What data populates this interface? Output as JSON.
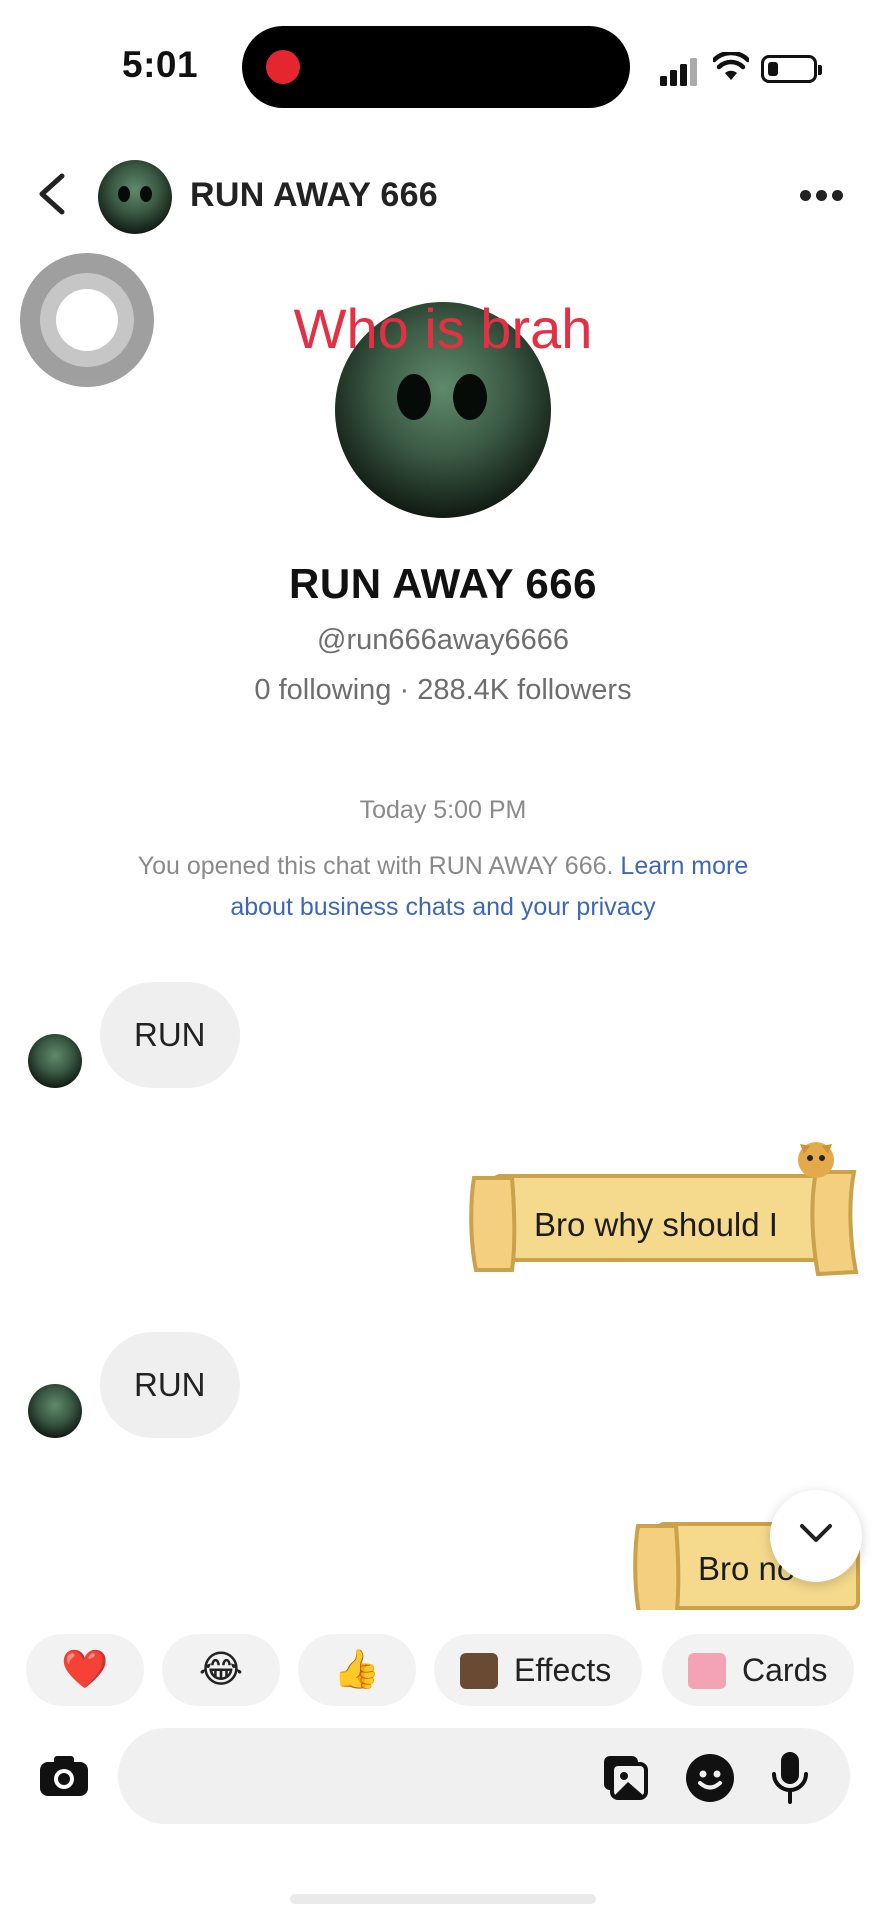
{
  "status_bar": {
    "time": "5:01"
  },
  "header": {
    "title": "RUN AWAY 666"
  },
  "overlay_caption": "Who is brah",
  "profile": {
    "name": "RUN AWAY 666",
    "handle": "@run666away6666",
    "stats": "0 following · 288.4K followers"
  },
  "chat": {
    "timestamp": "Today 5:00 PM",
    "notice_text": "You opened this chat with RUN AWAY 666. ",
    "notice_link": "Learn more about business chats and your privacy",
    "messages": [
      {
        "from": "them",
        "text": "RUN"
      },
      {
        "from": "me",
        "type": "sticker",
        "text": "Bro why should I"
      },
      {
        "from": "them",
        "text": "RUN"
      },
      {
        "from": "me",
        "type": "sticker",
        "text": "Bro no"
      }
    ]
  },
  "quick_reactions": [
    {
      "icon": "heart-icon",
      "emoji": "❤️"
    },
    {
      "icon": "laughing-icon",
      "emoji": "😂"
    },
    {
      "icon": "thumbs-up-icon",
      "emoji": "👍"
    },
    {
      "icon": "effects-icon",
      "label": "Effects"
    },
    {
      "icon": "cards-icon",
      "label": "Cards"
    }
  ],
  "composer": {
    "placeholder": ""
  },
  "colors": {
    "caption": "#e33045",
    "link": "#3f67b8",
    "record": "#e5262f",
    "sticker_paper": "#f5d98c"
  }
}
